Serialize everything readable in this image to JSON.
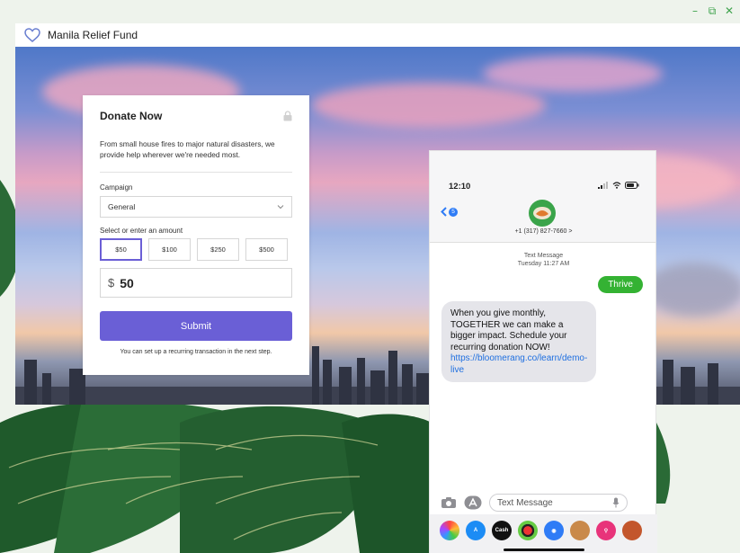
{
  "window": {
    "title": "Manila Relief Fund",
    "controls": {
      "minimize": "–",
      "restore": "⧉",
      "close": "✕"
    }
  },
  "donation_form": {
    "title": "Donate Now",
    "description": "From small house fires to major natural disasters, we provide help wherever we're needed most.",
    "campaign_label": "Campaign",
    "campaign_value": "General",
    "amount_label": "Select or enter an amount",
    "amount_options": [
      "$50",
      "$100",
      "$250",
      "$500"
    ],
    "selected_amount_index": 0,
    "currency_symbol": "$",
    "amount_value": "50",
    "submit_label": "Submit",
    "footnote": "You can set up a recurring transaction in the next step."
  },
  "phone": {
    "time": "12:10",
    "back_badge": "5",
    "contact_number": "+1 (317) 827-7660 >",
    "timestamp_line1": "Text Message",
    "timestamp_line2": "Tuesday 11:27 AM",
    "outgoing_message": "Thrive",
    "incoming_message": "When you give monthly, TOGETHER we can make a bigger impact. Schedule your recurring donation NOW!",
    "incoming_link": "https://bloomerang.co/learn/demo-live",
    "compose_placeholder": "Text Message",
    "tray_cash_label": "Cash"
  },
  "colors": {
    "accent": "#6a5fd6",
    "imessage_green": "#34b233",
    "link_blue": "#1f6fe0",
    "window_controls": "#3fa34d"
  },
  "icons": [
    "heart-icon",
    "lock-icon",
    "chevron-down-icon",
    "camera-icon",
    "app-store-icon",
    "microphone-icon"
  ]
}
